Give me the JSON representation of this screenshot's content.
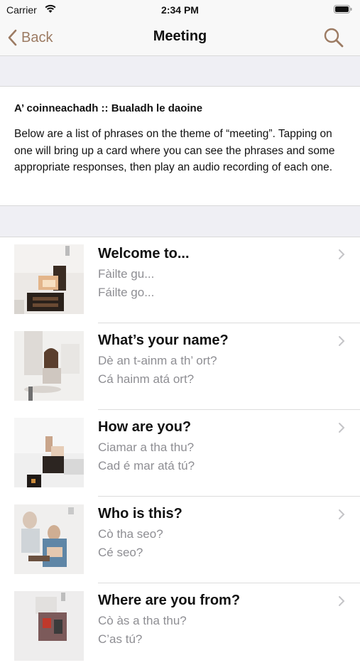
{
  "status_bar": {
    "carrier": "Carrier",
    "time": "2:34 PM"
  },
  "nav": {
    "back_label": "Back",
    "title": "Meeting"
  },
  "intro": {
    "title": "A’ coinneachadh :: Bualadh le daoine",
    "body": "Below are a list of phrases on the theme of “meeting”. Tapping on one will bring up a card where you can see the phrases and some appropriate responses, then play an audio recording of each one."
  },
  "phrases": [
    {
      "title": "Welcome to...",
      "scottish": "Fàilte gu...",
      "irish": "Fáilte go..."
    },
    {
      "title": "What’s your name?",
      "scottish": "Dè an t-ainm a th’ ort?",
      "irish": "Cá hainm atá ort?"
    },
    {
      "title": "How are you?",
      "scottish": "Ciamar a tha thu?",
      "irish": "Cad é mar atá tú?"
    },
    {
      "title": "Who is this?",
      "scottish": "Cò tha seo?",
      "irish": "Cé seo?"
    },
    {
      "title": "Where are you from?",
      "scottish": "Cò às a tha thu?",
      "irish": "C’as tú?"
    }
  ],
  "colors": {
    "accent": "#9c7b63",
    "secondary_text": "#8e8e93",
    "grouped_bg": "#efeff4"
  }
}
